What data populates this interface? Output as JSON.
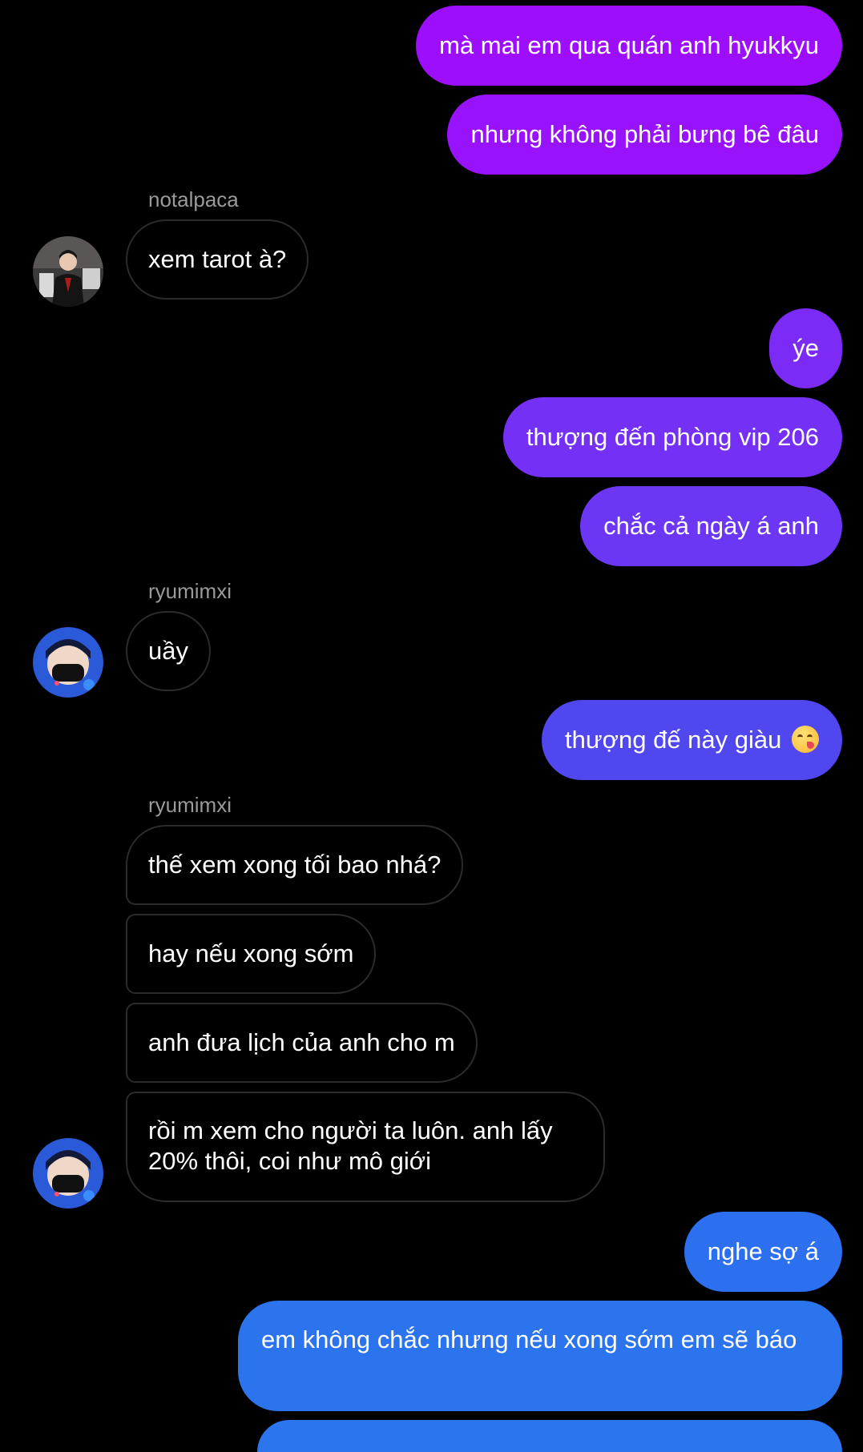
{
  "messages": {
    "m1": "mà mai em qua quán anh hyukkyu",
    "m2": "nhưng không phải bưng bê đâu",
    "m3_sender": "notalpaca",
    "m3": "xem tarot à?",
    "m4": "ýe",
    "m5": "thượng đến phòng vip 206",
    "m6": "chắc cả ngày á anh",
    "m7_sender": "ryumimxi",
    "m7": "uầy",
    "m8": "thượng đế này giàu",
    "m9_sender": "ryumimxi",
    "m9": "thế xem xong tối bao nhá?",
    "m10": "hay nếu xong sớm",
    "m11": "anh đưa lịch của anh cho m",
    "m12": "rồi m xem cho người ta luôn. anh lấy 20% thôi, coi như mô giới",
    "m13": "nghe sợ á",
    "m14": "em không chắc nhưng nếu xong sớm em sẽ báo"
  },
  "icons": {
    "m8_emoji": "face-savoring-food-emoji",
    "avatar_notalpaca": "avatar-notalpaca",
    "avatar_ryumimxi": "avatar-ryumimxi"
  },
  "colors": {
    "outgoing_gradient_top": "#9a13fb",
    "outgoing_gradient_mid": "#6b3ef2",
    "outgoing_gradient_bottom": "#2f74ee",
    "incoming_border": "#2b2b2b",
    "sender_name": "#9a9a9a",
    "background": "#000000"
  }
}
